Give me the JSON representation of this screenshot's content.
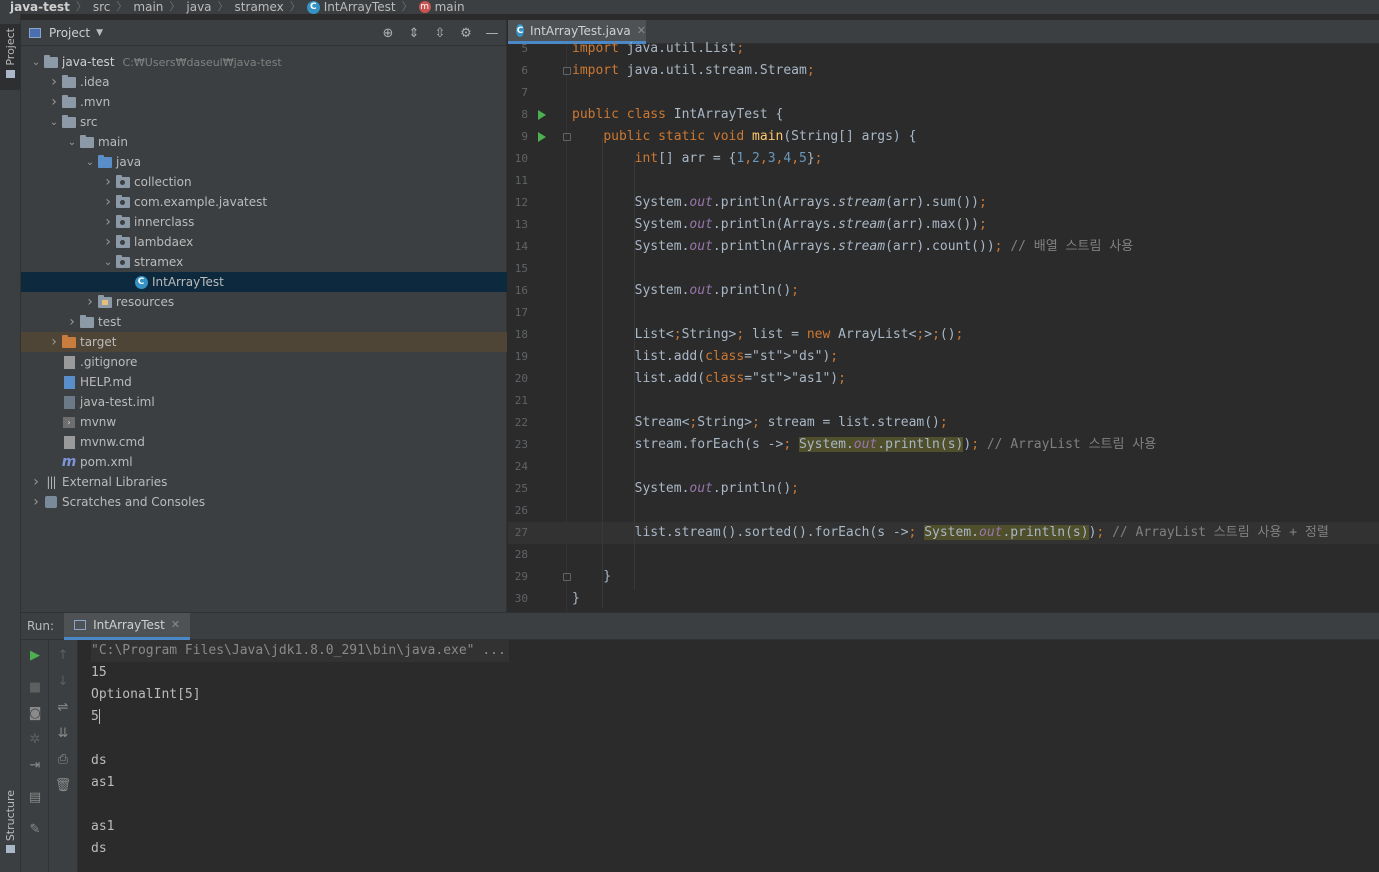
{
  "breadcrumb": [
    "java-test",
    "src",
    "main",
    "java",
    "stramex",
    "IntArrayTest",
    "main"
  ],
  "left_strip": {
    "project_label": "Project",
    "structure_label": "Structure"
  },
  "project_panel": {
    "title": "Project",
    "root_path": "C:₩Users₩daseul₩java-test",
    "tree": [
      {
        "label": "java-test",
        "depth": 0,
        "arrow": "open",
        "icon": "module"
      },
      {
        "label": ".idea",
        "depth": 1,
        "arrow": "closed",
        "icon": "folder"
      },
      {
        "label": ".mvn",
        "depth": 1,
        "arrow": "closed",
        "icon": "folder"
      },
      {
        "label": "src",
        "depth": 1,
        "arrow": "open",
        "icon": "folder"
      },
      {
        "label": "main",
        "depth": 2,
        "arrow": "open",
        "icon": "folder"
      },
      {
        "label": "java",
        "depth": 3,
        "arrow": "open",
        "icon": "folder-blue"
      },
      {
        "label": "collection",
        "depth": 4,
        "arrow": "closed",
        "icon": "package"
      },
      {
        "label": "com.example.javatest",
        "depth": 4,
        "arrow": "closed",
        "icon": "package"
      },
      {
        "label": "innerclass",
        "depth": 4,
        "arrow": "closed",
        "icon": "package"
      },
      {
        "label": "lambdaex",
        "depth": 4,
        "arrow": "closed",
        "icon": "package"
      },
      {
        "label": "stramex",
        "depth": 4,
        "arrow": "open",
        "icon": "package"
      },
      {
        "label": "IntArrayTest",
        "depth": 5,
        "arrow": "none",
        "icon": "class",
        "selected": true
      },
      {
        "label": "resources",
        "depth": 3,
        "arrow": "closed",
        "icon": "resources"
      },
      {
        "label": "test",
        "depth": 2,
        "arrow": "closed",
        "icon": "folder"
      },
      {
        "label": "target",
        "depth": 1,
        "arrow": "closed",
        "icon": "folder-orange",
        "excluded": true
      },
      {
        "label": ".gitignore",
        "depth": 1,
        "arrow": "none",
        "icon": "file"
      },
      {
        "label": "HELP.md",
        "depth": 1,
        "arrow": "none",
        "icon": "md"
      },
      {
        "label": "java-test.iml",
        "depth": 1,
        "arrow": "none",
        "icon": "iml"
      },
      {
        "label": "mvnw",
        "depth": 1,
        "arrow": "none",
        "icon": "terminal"
      },
      {
        "label": "mvnw.cmd",
        "depth": 1,
        "arrow": "none",
        "icon": "file"
      },
      {
        "label": "pom.xml",
        "depth": 1,
        "arrow": "none",
        "icon": "maven"
      },
      {
        "label": "External Libraries",
        "depth": 0,
        "arrow": "closed",
        "icon": "libraries"
      },
      {
        "label": "Scratches and Consoles",
        "depth": 0,
        "arrow": "closed",
        "icon": "scratches"
      }
    ]
  },
  "editor": {
    "tab_label": "IntArrayTest.java",
    "current_line": "27",
    "lines": [
      {
        "n": "5",
        "text": "import java.util.List;"
      },
      {
        "n": "6",
        "text": "import java.util.stream.Stream;"
      },
      {
        "n": "7",
        "text": ""
      },
      {
        "n": "8",
        "text": "public class IntArrayTest {"
      },
      {
        "n": "9",
        "text": "    public static void main(String[] args) {"
      },
      {
        "n": "10",
        "text": "        int[] arr = {1,2,3,4,5};"
      },
      {
        "n": "11",
        "text": ""
      },
      {
        "n": "12",
        "text": "        System.out.println(Arrays.stream(arr).sum());"
      },
      {
        "n": "13",
        "text": "        System.out.println(Arrays.stream(arr).max());"
      },
      {
        "n": "14",
        "text": "        System.out.println(Arrays.stream(arr).count()); // 배열 스트림 사용"
      },
      {
        "n": "15",
        "text": ""
      },
      {
        "n": "16",
        "text": "        System.out.println();"
      },
      {
        "n": "17",
        "text": ""
      },
      {
        "n": "18",
        "text": "        List<String> list = new ArrayList<>();"
      },
      {
        "n": "19",
        "text": "        list.add(\"ds\");"
      },
      {
        "n": "20",
        "text": "        list.add(\"as1\");"
      },
      {
        "n": "21",
        "text": ""
      },
      {
        "n": "22",
        "text": "        Stream<String> stream = list.stream();"
      },
      {
        "n": "23",
        "text": "        stream.forEach(s -> System.out.println(s)); // ArrayList 스트림 사용"
      },
      {
        "n": "24",
        "text": ""
      },
      {
        "n": "25",
        "text": "        System.out.println();"
      },
      {
        "n": "26",
        "text": ""
      },
      {
        "n": "27",
        "text": "        list.stream().sorted().forEach(s -> System.out.println(s)); // ArrayList 스트림 사용 + 정렬"
      },
      {
        "n": "28",
        "text": ""
      },
      {
        "n": "29",
        "text": "    }"
      },
      {
        "n": "30",
        "text": "}"
      }
    ]
  },
  "run_panel": {
    "label": "Run:",
    "tab_label": "IntArrayTest",
    "output": [
      "\"C:\\Program Files\\Java\\jdk1.8.0_291\\bin\\java.exe\" ...",
      "15",
      "OptionalInt[5]",
      "5",
      "",
      "ds",
      "as1",
      "",
      "as1",
      "ds"
    ]
  },
  "colors": {
    "keyword": "#cc7832",
    "method": "#ffc66d",
    "string": "#6a8759",
    "number": "#6897bb",
    "field": "#9876aa",
    "comment": "#808080",
    "run_green": "#4caf50",
    "selection": "#0d293e",
    "tab_accent": "#4a88c7"
  }
}
